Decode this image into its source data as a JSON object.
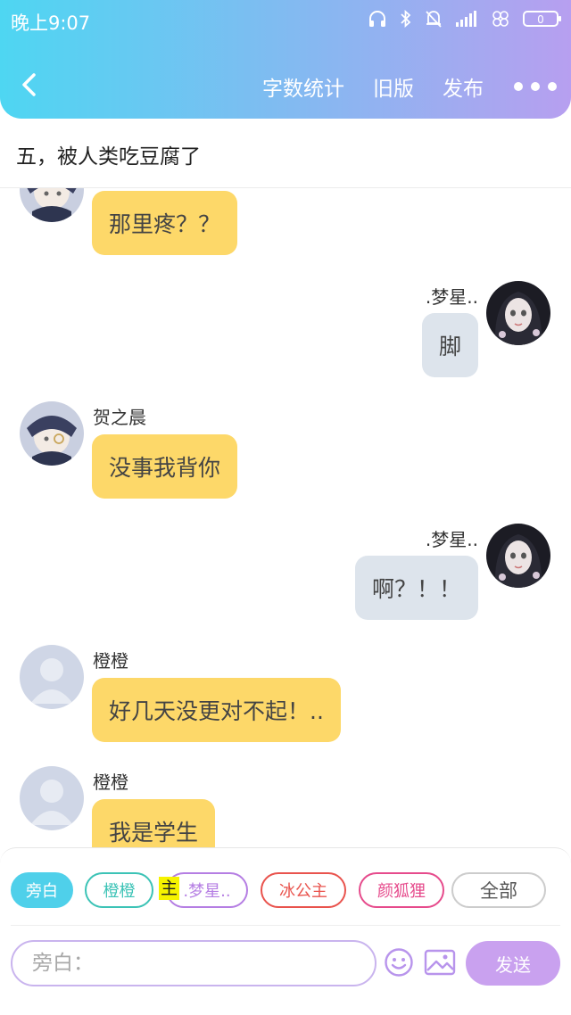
{
  "status_bar": {
    "time": "晚上9:07",
    "icons": [
      "headphones-icon",
      "bluetooth-icon",
      "mute-bell-icon",
      "signal-icon",
      "clover-icon",
      "battery-icon"
    ],
    "battery_level": "0"
  },
  "header": {
    "back_icon": "chevron-left-icon",
    "actions": [
      "字数统计",
      "旧版",
      "发布"
    ],
    "more_icon": "more-dots-icon"
  },
  "chapter_title": "五，被人类吃豆腐了",
  "messages": [
    {
      "side": "left",
      "name": "",
      "avatar": "anime-boy-avatar",
      "text": "那里疼？？"
    },
    {
      "side": "right",
      "name": ".梦星..",
      "avatar": "anime-girl-avatar",
      "text": "脚"
    },
    {
      "side": "left",
      "name": "贺之晨",
      "avatar": "anime-boy-avatar",
      "text": "没事我背你"
    },
    {
      "side": "right",
      "name": ".梦星..",
      "avatar": "anime-girl-avatar",
      "text": "啊？！！"
    },
    {
      "side": "left",
      "name": "橙橙",
      "avatar": "default-user-avatar",
      "text": "好几天没更对不起！.."
    },
    {
      "side": "left",
      "name": "橙橙",
      "avatar": "default-user-avatar",
      "text": "我是学生"
    }
  ],
  "roles": [
    {
      "label": "旁白",
      "color": "#4fd0ea",
      "selected": true
    },
    {
      "label": "橙橙",
      "color": "#3cc3b6",
      "selected": false
    },
    {
      "label": ".梦星..",
      "color": "#b57ee3",
      "selected": false
    },
    {
      "label": "冰公主",
      "color": "#e9534d",
      "selected": false
    },
    {
      "label": "颜狐狸",
      "color": "#e64b8c",
      "selected": false
    },
    {
      "label": "全部",
      "color": "#bbbbbb",
      "selected": false
    }
  ],
  "main_tag": "主",
  "composer": {
    "placeholder": "旁白：",
    "emoji_icon": "smiley-icon",
    "image_icon": "image-icon",
    "send_label": "发送"
  },
  "colors": {
    "header_gradient": [
      "#4ed6f2",
      "#b79ff0"
    ],
    "left_bubble": "#fdd869",
    "right_bubble": "#dde4ec",
    "send_button": "#c9a1ef"
  }
}
